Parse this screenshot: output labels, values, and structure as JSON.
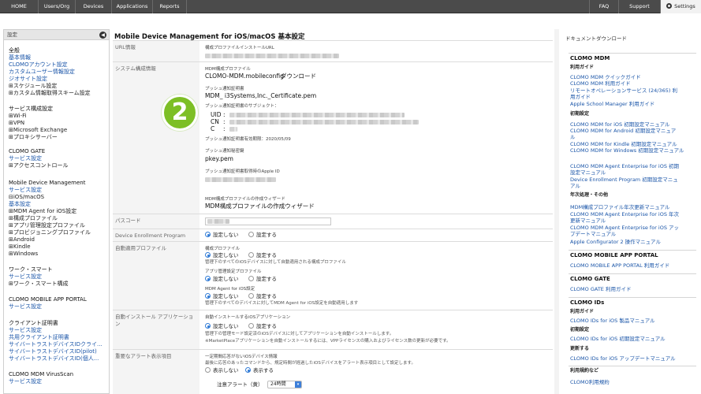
{
  "nav": {
    "left": [
      "HOME",
      "Users/Org",
      "Devices",
      "Applications",
      "Reports"
    ],
    "right": [
      "FAQ",
      "Support",
      "Settings"
    ]
  },
  "sidebar": {
    "header": "設定",
    "collapse_icon": "◀",
    "items": [
      {
        "text": "全般",
        "kind": "h"
      },
      {
        "text": "基本情報",
        "kind": "l"
      },
      {
        "text": "CLOMOアカウント設定",
        "kind": "l"
      },
      {
        "text": "カスタムユーザー情報設定",
        "kind": "l"
      },
      {
        "text": "ジオサイト設定",
        "kind": "l"
      },
      {
        "text": "⊞スケジュール設定",
        "kind": "t"
      },
      {
        "text": "⊞カスタム情報取得スキーム設定",
        "kind": "t"
      },
      {
        "text": "サービス構成設定",
        "kind": "h"
      },
      {
        "text": "⊞Wi-Fi",
        "kind": "t"
      },
      {
        "text": "⊞VPN",
        "kind": "t"
      },
      {
        "text": "⊞Microsoft Exchange",
        "kind": "t"
      },
      {
        "text": "⊞プロキシサーバー",
        "kind": "t"
      },
      {
        "text": "CLOMO GATE",
        "kind": "h"
      },
      {
        "text": "サービス設定",
        "kind": "l"
      },
      {
        "text": "⊞アクセスコントロール",
        "kind": "t"
      },
      {
        "text": "Mobile Device Management",
        "kind": "h"
      },
      {
        "text": "サービス設定",
        "kind": "l"
      },
      {
        "text": "⊟iOS/macOS",
        "kind": "t"
      },
      {
        "text": "基本設定",
        "kind": "l"
      },
      {
        "text": "⊞MDM Agent for iOS設定",
        "kind": "t"
      },
      {
        "text": "⊞構成プロファイル",
        "kind": "t"
      },
      {
        "text": "⊞アプリ管理設定プロファイル",
        "kind": "t"
      },
      {
        "text": "⊞プロビジョニングプロファイル",
        "kind": "t"
      },
      {
        "text": "⊞Android",
        "kind": "t"
      },
      {
        "text": "⊞Kindle",
        "kind": "t"
      },
      {
        "text": "⊞Windows",
        "kind": "t"
      },
      {
        "text": "ワーク・スマート",
        "kind": "h"
      },
      {
        "text": "サービス設定",
        "kind": "l"
      },
      {
        "text": "⊞ワーク・スマート構成",
        "kind": "t"
      },
      {
        "text": "CLOMO MOBILE APP PORTAL",
        "kind": "h"
      },
      {
        "text": "サービス設定",
        "kind": "l"
      },
      {
        "text": "クライアント証明書",
        "kind": "h"
      },
      {
        "text": "サービス設定",
        "kind": "l"
      },
      {
        "text": "共用クライアント証明書",
        "kind": "l"
      },
      {
        "text": "サイバートラストデバイスIDクライ...",
        "kind": "l"
      },
      {
        "text": "サイバートラストデバイスID(pilot)",
        "kind": "l"
      },
      {
        "text": "サイバートラストデバイスID(個人...",
        "kind": "l"
      },
      {
        "text": "CLOMO MDM VirusScan",
        "kind": "h"
      },
      {
        "text": "サービス設定",
        "kind": "l"
      }
    ]
  },
  "main": {
    "title": "Mobile Device Management for iOS/macOS 基本設定",
    "badge": "2",
    "url": {
      "label": "URL情報",
      "sub": "構成プロファイルインストールURL"
    },
    "system": {
      "label": "システム構成情報",
      "mdm_profile_label": "MDM構成プロファイル",
      "mdm_profile_file": "CLOMO-MDM.mobileconfig",
      "download": "ダウンロード",
      "push_cert_label": "プッシュ通知証明書",
      "push_cert_file": "MDM_ i3Systems,Inc._Certificate.pem",
      "subject_label": "プッシュ通知証明書のサブジェクト：",
      "uid": "UID",
      "cn": "CN",
      "c": "C",
      "expiry": "プッシュ通知証明書有効期限：2020/05/09",
      "secret_label": "プッシュ通知秘密鍵",
      "secret_file": "pkey.pem",
      "appleid_label": "プッシュ通知証明書取得時のApple ID",
      "wizard_label": "MDM構成プロファイルの作成ウィザード",
      "wizard_link": "MDM構成プロファイルの作成ウィザード"
    },
    "passcode": {
      "label": "パスコード"
    },
    "dep": {
      "label": "Device Enrollment Program",
      "opt_off": "設定しない",
      "opt_on": "設定する"
    },
    "auto": {
      "label": "自動適用プロファイル",
      "cfg_label": "構成プロファイル",
      "cfg_note": "管理下のすべてのiOSデバイスに対して自動適用される構成プロファイル",
      "app_label": "アプリ管理設定プロファイル",
      "agent_label": "MDM Agent for iOS設定",
      "agent_note": "管理下のすべてのデバイスに対してMDM Agent for iOS設定を自動適用します",
      "opt_off": "設定しない",
      "opt_on": "設定する"
    },
    "install": {
      "label": "自動インストール アプリケーション",
      "sub": "自動インストールするiOSアプリケーション",
      "note1": "管理下の管理モード設定済のiOSデバイスに対してアプリケーションを自動インストールします。",
      "note2": "※MarketPlaceアプリケーションを自動インストールするには、VPPライセンスの購入およびライセンス数の更新が必要です。",
      "opt_off": "設定しない",
      "opt_on": "設定する"
    },
    "alert": {
      "label": "重要なアラート表示項目",
      "sub": "一定期間応答がないiOSデバイス情報",
      "note": "最後に応答のあったコマンドから、規定時間が経過したiOSデバイスをアラート表示項目として設定します。",
      "opt_off": "表示しない",
      "opt_on": "表示する",
      "level_label": "注意アラート（黄）",
      "level_value": "24時間"
    }
  },
  "right": {
    "title": "ドキュメントダウンロード",
    "items": [
      {
        "text": "CLOMO MDM",
        "kind": "h"
      },
      {
        "text": "利用ガイド",
        "kind": "s"
      },
      {
        "text": "CLOMO MDM クイックガイド",
        "kind": "l"
      },
      {
        "text": "CLOMO MDM 利用ガイド",
        "kind": "l"
      },
      {
        "text": "リモートオペレーションサービス (24/365) 利",
        "kind": "l"
      },
      {
        "text": "用ガイド",
        "kind": "l"
      },
      {
        "text": "Apple School Manager 利用ガイド",
        "kind": "l"
      },
      {
        "text": "初期設定",
        "kind": "s"
      },
      {
        "text": "CLOMO MDM for iOS 初期設定マニュアル",
        "kind": "l"
      },
      {
        "text": "CLOMO MDM for Android 初期設定マニュア",
        "kind": "l"
      },
      {
        "text": "ル",
        "kind": "l"
      },
      {
        "text": "CLOMO MDM for Kindle 初期設定マニュアル",
        "kind": "l"
      },
      {
        "text": "CLOMO MDM for Windows 初期設定マニュアル",
        "kind": "l"
      },
      {
        "text": "CLOMO MDM Agent Enterprise for iOS 初期",
        "kind": "l"
      },
      {
        "text": "設定マニュアル",
        "kind": "l"
      },
      {
        "text": "Device Enrollment Program 初期設定マニュ",
        "kind": "l"
      },
      {
        "text": "アル",
        "kind": "l"
      },
      {
        "text": "年次処理・その他",
        "kind": "s"
      },
      {
        "text": "MDM構成プロファイル年次更新マニュアル",
        "kind": "l"
      },
      {
        "text": "CLOMO MDM Agent Enterprise for iOS 年次",
        "kind": "l"
      },
      {
        "text": "更新マニュアル",
        "kind": "l"
      },
      {
        "text": "CLOMO MDM Agent Enterprise for iOS アッ",
        "kind": "l"
      },
      {
        "text": "プデートマニュアル",
        "kind": "l"
      },
      {
        "text": "Apple Configurator 2 操作マニュアル",
        "kind": "l"
      },
      {
        "text": "CLOMO MOBILE APP PORTAL",
        "kind": "h"
      },
      {
        "text": "CLOMO MOBILE APP PORTAL 利用ガイド",
        "kind": "l"
      },
      {
        "text": "CLOMO GATE",
        "kind": "h"
      },
      {
        "text": "CLOMO GATE 利用ガイド",
        "kind": "l"
      },
      {
        "text": "CLOMO IDs",
        "kind": "h"
      },
      {
        "text": "利用ガイド",
        "kind": "s"
      },
      {
        "text": "CLOMO IDs for iOS 製品マニュアル",
        "kind": "l"
      },
      {
        "text": "初期設定",
        "kind": "s"
      },
      {
        "text": "CLOMO IDs for iOS 初期設定マニュアル",
        "kind": "l"
      },
      {
        "text": "更新する",
        "kind": "s"
      },
      {
        "text": "CLOMO IDs for iOS アップデートマニュアル",
        "kind": "l"
      },
      {
        "text": "利用規約など",
        "kind": "s"
      },
      {
        "text": "CLOMO利用規約",
        "kind": "l"
      }
    ]
  }
}
